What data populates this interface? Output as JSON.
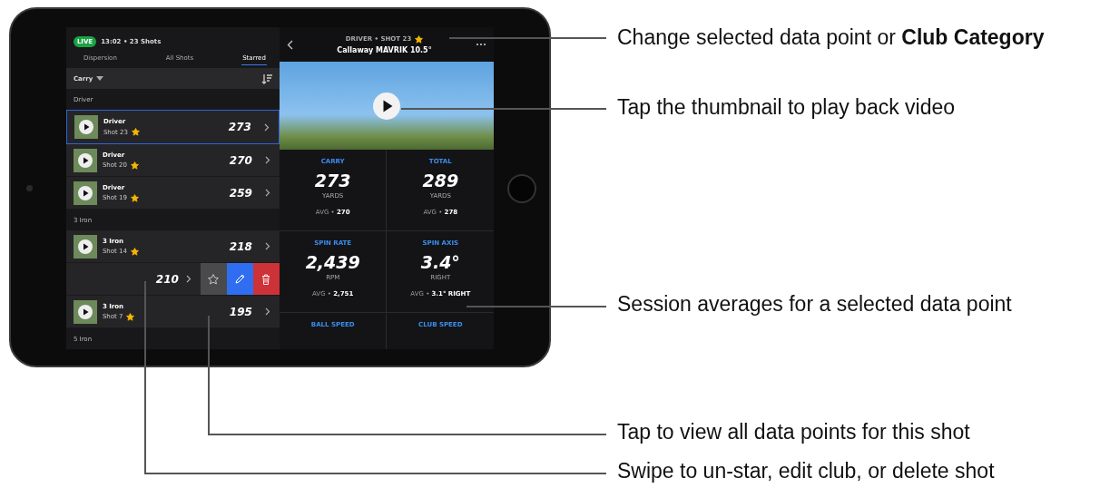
{
  "session": {
    "live": "LIVE",
    "summary": "13:02 • 23 Shots"
  },
  "tabs": [
    {
      "label": "Dispersion",
      "selected": false
    },
    {
      "label": "All Shots",
      "selected": false
    },
    {
      "label": "Starred",
      "selected": true
    }
  ],
  "sort": {
    "label": "Carry"
  },
  "groups": [
    {
      "name": "Driver",
      "shots": [
        {
          "kind": "row",
          "club": "Driver",
          "shot": "Shot 23",
          "starred": true,
          "value": "273",
          "selected": true
        },
        {
          "kind": "row",
          "club": "Driver",
          "shot": "Shot 20",
          "starred": true,
          "value": "270",
          "selected": false
        },
        {
          "kind": "row",
          "club": "Driver",
          "shot": "Shot 19",
          "starred": true,
          "value": "259",
          "selected": false
        }
      ]
    },
    {
      "name": "3 Iron",
      "shots": [
        {
          "kind": "row",
          "club": "3 Iron",
          "shot": "Shot 14",
          "starred": true,
          "value": "218",
          "selected": false
        },
        {
          "kind": "swiped",
          "value": "210",
          "selected": false
        },
        {
          "kind": "row",
          "club": "3 Iron",
          "shot": "Shot 7",
          "starred": true,
          "value": "195",
          "selected": false
        }
      ]
    },
    {
      "name": "5 Iron"
    }
  ],
  "detail": {
    "subtitle": "DRIVER • SHOT 23",
    "starred": true,
    "title": "Callaway MAVRIK 10.5°"
  },
  "metrics": [
    {
      "label": "CARRY",
      "value": "273",
      "unit": "YARDS",
      "avg_label": "AVG •",
      "avg": "270"
    },
    {
      "label": "TOTAL",
      "value": "289",
      "unit": "YARDS",
      "avg_label": "AVG •",
      "avg": "278"
    },
    {
      "label": "SPIN RATE",
      "value": "2,439",
      "unit": "RPM",
      "avg_label": "AVG •",
      "avg": "2,751"
    },
    {
      "label": "SPIN AXIS",
      "value": "3.4°",
      "unit": "RIGHT",
      "avg_label": "AVG •",
      "avg": "3.1° RIGHT"
    },
    {
      "label": "BALL SPEED"
    },
    {
      "label": "CLUB SPEED"
    }
  ],
  "annotations": [
    "Change selected data point or **Club Category**",
    "Tap the thumbnail to play back video",
    "Session averages for a selected data point",
    "Tap to view all data points for this shot",
    "Swipe to un-star, edit club, or delete shot"
  ]
}
